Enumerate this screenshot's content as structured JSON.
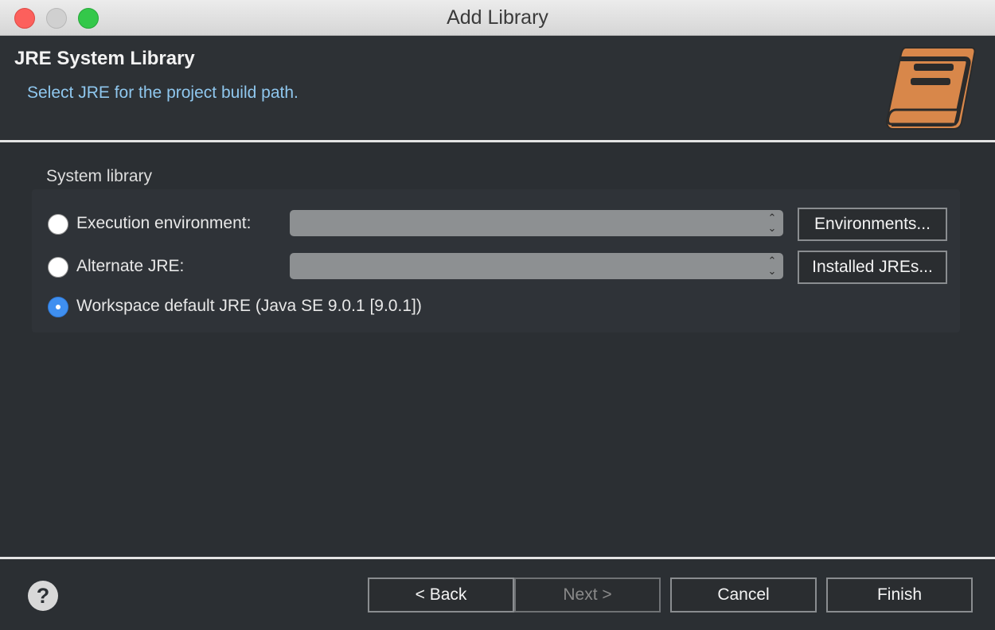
{
  "window": {
    "title": "Add Library"
  },
  "header": {
    "title": "JRE System Library",
    "subtitle": "Select JRE for the project build path.",
    "icon": "library-book-icon",
    "icon_color": "#d8874a"
  },
  "system_library": {
    "group_label": "System library",
    "options": [
      {
        "label": "Execution environment:",
        "selected": false,
        "combo_value": "",
        "button": "Environments..."
      },
      {
        "label": "Alternate JRE:",
        "selected": false,
        "combo_value": "",
        "button": "Installed JREs..."
      },
      {
        "label": "Workspace default JRE (Java SE 9.0.1 [9.0.1])",
        "selected": true
      }
    ]
  },
  "footer": {
    "help_icon": "help-icon",
    "help_glyph": "?",
    "back": "< Back",
    "next": "Next >",
    "cancel": "Cancel",
    "finish": "Finish"
  },
  "colors": {
    "background": "#2b2f33",
    "subtitle": "#8fc7ee",
    "radio_selected": "#3f8ff0"
  }
}
